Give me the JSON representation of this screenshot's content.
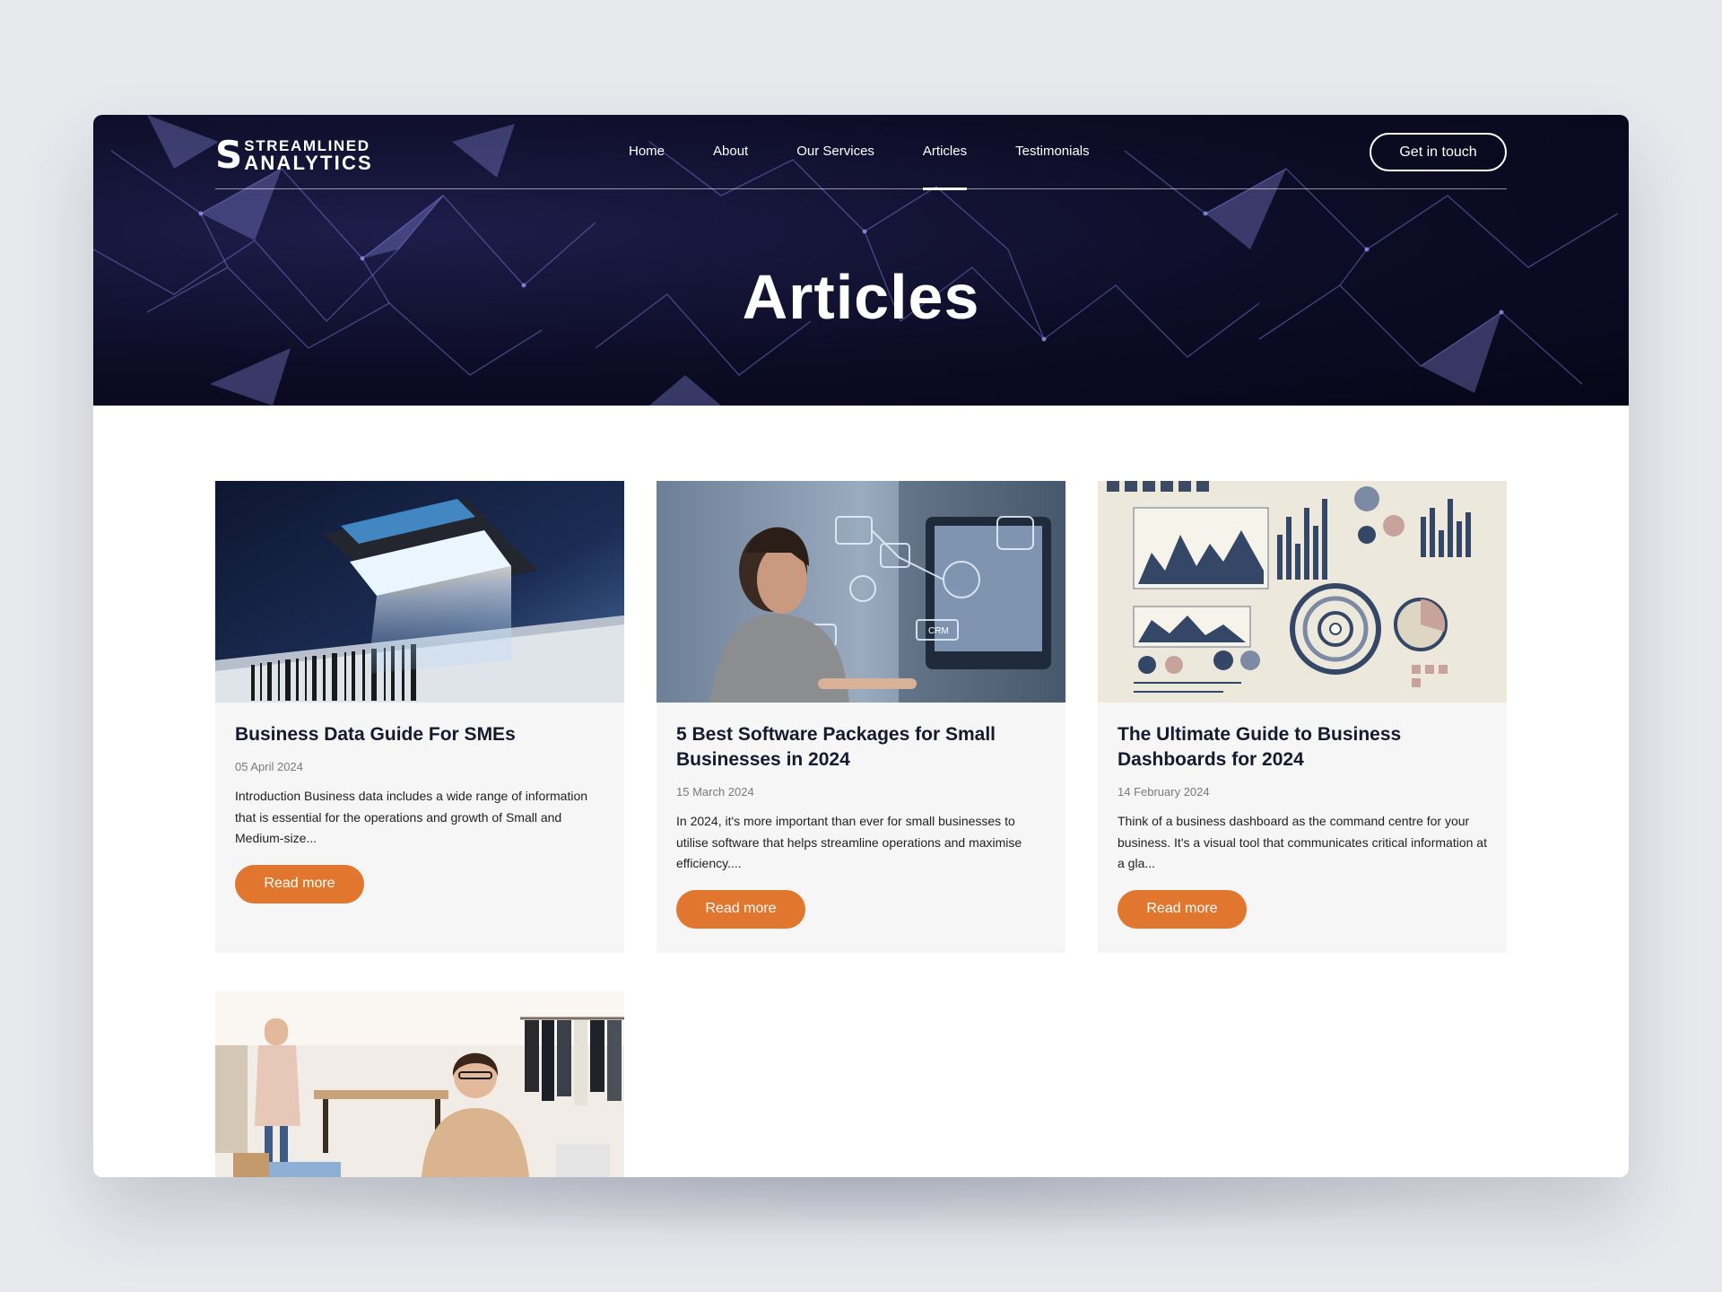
{
  "brand": {
    "line1": "STREAMLINED",
    "line2": "ANALYTICS",
    "mark": "S"
  },
  "nav": {
    "items": [
      {
        "label": "Home",
        "active": false
      },
      {
        "label": "About",
        "active": false
      },
      {
        "label": "Our Services",
        "active": false
      },
      {
        "label": "Articles",
        "active": true
      },
      {
        "label": "Testimonials",
        "active": false
      }
    ],
    "cta": "Get in touch"
  },
  "hero": {
    "title": "Articles"
  },
  "articles": [
    {
      "title": "Business Data Guide For SMEs",
      "date": "05 April 2024",
      "excerpt": "Introduction Business data includes a wide range of information that is essential for the operations and growth of Small and Medium-size...",
      "button": "Read more",
      "image": "barcode-scanner-photo"
    },
    {
      "title": "5 Best Software Packages for Small Businesses in 2024",
      "date": "15 March 2024",
      "excerpt": "In 2024, it's more important than ever for small businesses to utilise software that helps streamline operations and maximise efficiency....",
      "button": "Read more",
      "image": "woman-at-computer-crm-photo",
      "image_text": "CRM"
    },
    {
      "title": "The Ultimate Guide to Business Dashboards for 2024",
      "date": "14 February 2024",
      "excerpt": "Think of a business dashboard as the command centre for your business. It's a visual tool that communicates critical information at a gla...",
      "button": "Read more",
      "image": "dashboard-infographic-illustration"
    },
    {
      "title": "",
      "image": "boutique-shop-photo"
    }
  ],
  "colors": {
    "accent": "#e1762f",
    "hero_bg": "#0d0c26",
    "page_bg": "#e8e9ed",
    "card_bg": "#f6f6f6",
    "title": "#151a30"
  }
}
